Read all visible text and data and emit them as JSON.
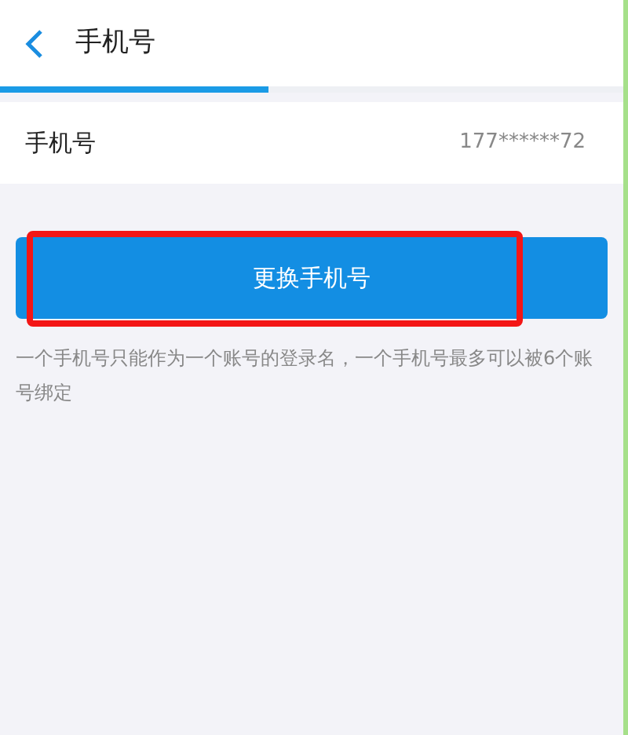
{
  "header": {
    "title": "手机号",
    "loading": {
      "level": 0.43
    }
  },
  "phone_row": {
    "label": "手机号",
    "value": "177******72"
  },
  "button": {
    "label": "更换手机号",
    "highlighted": true
  },
  "note": "一个手机号只能作为一个账号的登录名，一个手机号最多可以被6个账号绑定"
}
